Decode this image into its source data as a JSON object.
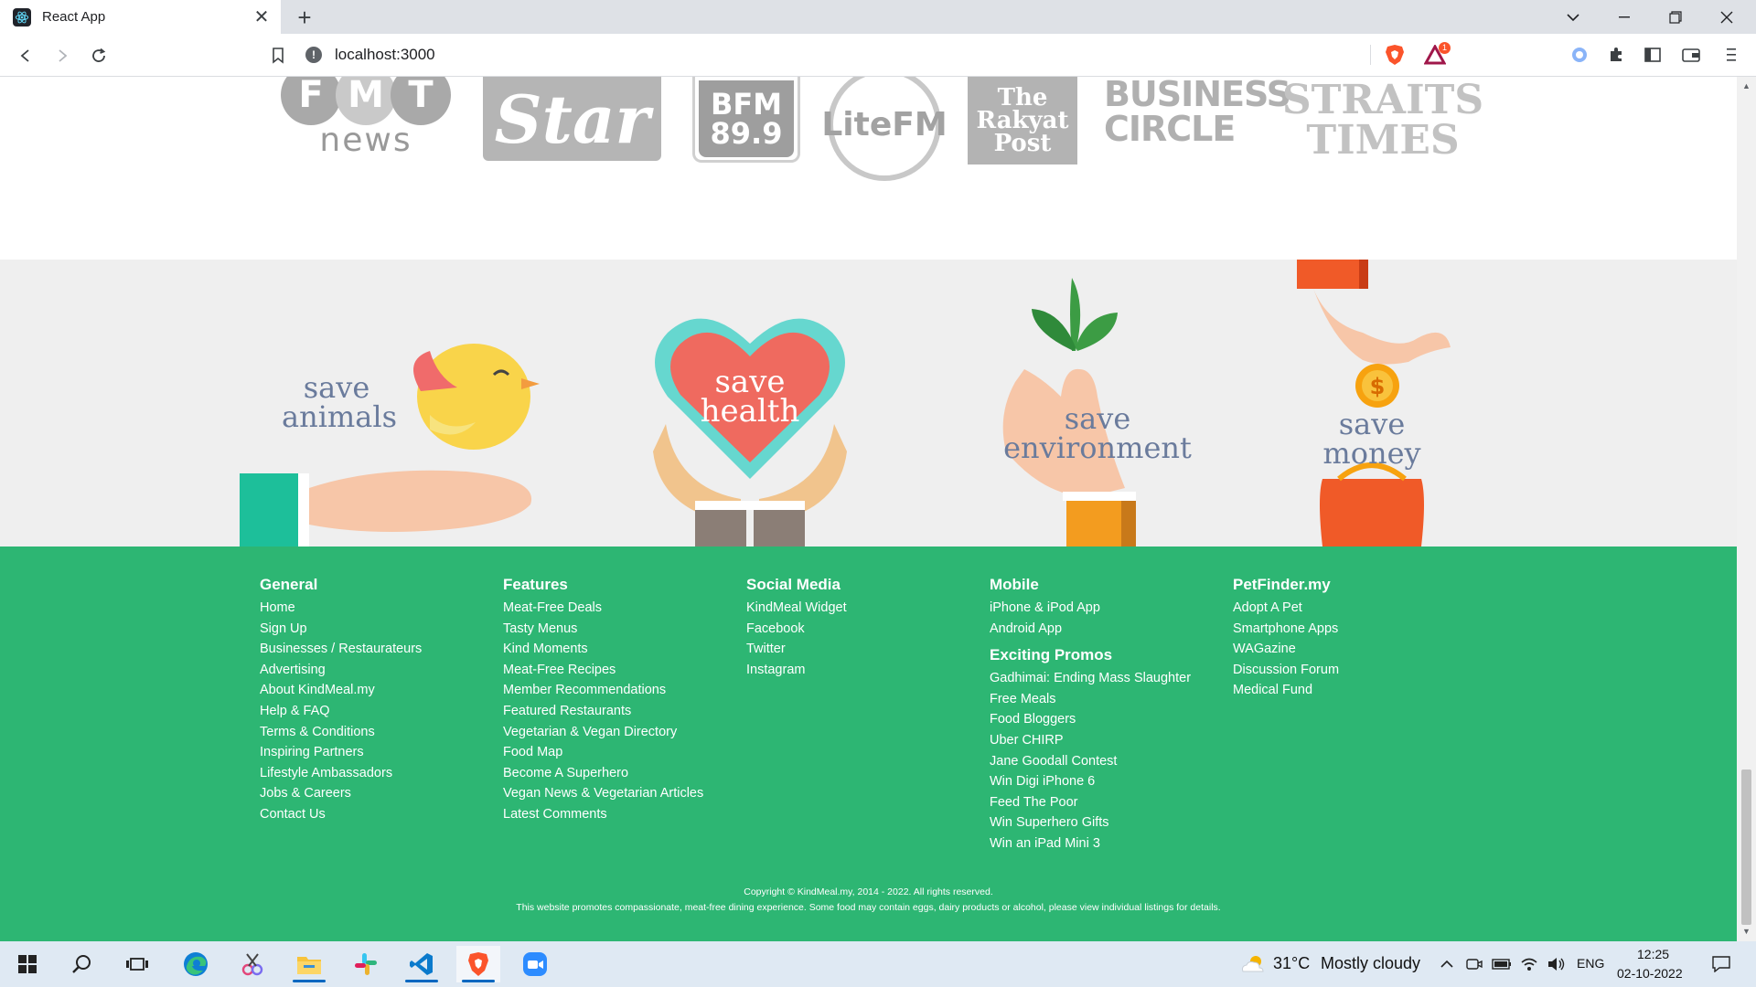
{
  "browser": {
    "tab_title": "React App",
    "url": "localhost:3000",
    "brave_badge": "1"
  },
  "logos": [
    {
      "name": "FMT news",
      "letters": [
        "F",
        "M",
        "T"
      ],
      "sub": "news"
    },
    {
      "name": "The Star",
      "text": "Star"
    },
    {
      "name": "BFM 89.9",
      "line1": "BFM",
      "line2": "89.9"
    },
    {
      "name": "Lite FM",
      "text": "LiteFM"
    },
    {
      "name": "The Rakyat Post",
      "lines": [
        "The",
        "Rakyat",
        "Post"
      ]
    },
    {
      "name": "Business Circle",
      "lines": [
        "BUSINESS",
        "CIRCLE"
      ]
    },
    {
      "name": "Straits Times",
      "lines": [
        "STRAITS",
        "TIMES"
      ]
    }
  ],
  "save": {
    "animals": {
      "l1": "save",
      "l2": "animals"
    },
    "health": {
      "l1": "save",
      "l2": "health"
    },
    "environment": {
      "l1": "save",
      "l2": "environment"
    },
    "money": {
      "l1": "save",
      "l2": "money"
    }
  },
  "footer": {
    "general": {
      "heading": "General",
      "links": [
        "Home",
        "Sign Up",
        "Businesses / Restaurateurs",
        "Advertising",
        "About KindMeal.my",
        "Help & FAQ",
        "Terms & Conditions",
        "Inspiring Partners",
        "Lifestyle Ambassadors",
        "Jobs & Careers",
        "Contact Us"
      ]
    },
    "features": {
      "heading": "Features",
      "links": [
        "Meat-Free Deals",
        "Tasty Menus",
        "Kind Moments",
        "Meat-Free Recipes",
        "Member Recommendations",
        "Featured Restaurants",
        "Vegetarian & Vegan Directory",
        "Food Map",
        "Become A Superhero",
        "Vegan News & Vegetarian Articles",
        "Latest Comments"
      ]
    },
    "social": {
      "heading": "Social Media",
      "links": [
        "KindMeal Widget",
        "Facebook",
        "Twitter",
        "Instagram"
      ]
    },
    "mobile": {
      "heading": "Mobile",
      "links": [
        "iPhone & iPod App",
        "Android App"
      ]
    },
    "promos": {
      "heading": "Exciting Promos",
      "links": [
        "Gadhimai: Ending Mass Slaughter",
        "Free Meals",
        "Food Bloggers",
        "Uber CHIRP",
        "Jane Goodall Contest",
        "Win Digi iPhone 6",
        "Feed The Poor",
        "Win Superhero Gifts",
        "Win an iPad Mini 3"
      ]
    },
    "petfinder": {
      "heading": "PetFinder.my",
      "links": [
        "Adopt A Pet",
        "Smartphone Apps",
        "WAGazine",
        "Discussion Forum",
        "Medical Fund"
      ]
    },
    "copyright": "Copyright © KindMeal.my, 2014 - 2022. All rights reserved.",
    "disclaimer": "This website promotes compassionate, meat-free dining experience. Some food may contain eggs, dairy products or alcohol, please view individual listings for details."
  },
  "taskbar": {
    "weather_temp": "31°C",
    "weather_desc": "Mostly cloudy",
    "language": "ENG",
    "time": "12:25",
    "date": "02-10-2022"
  },
  "colors": {
    "footer_green": "#2db673",
    "band_grey": "#efefef",
    "save_text": "#6a7b9c"
  }
}
